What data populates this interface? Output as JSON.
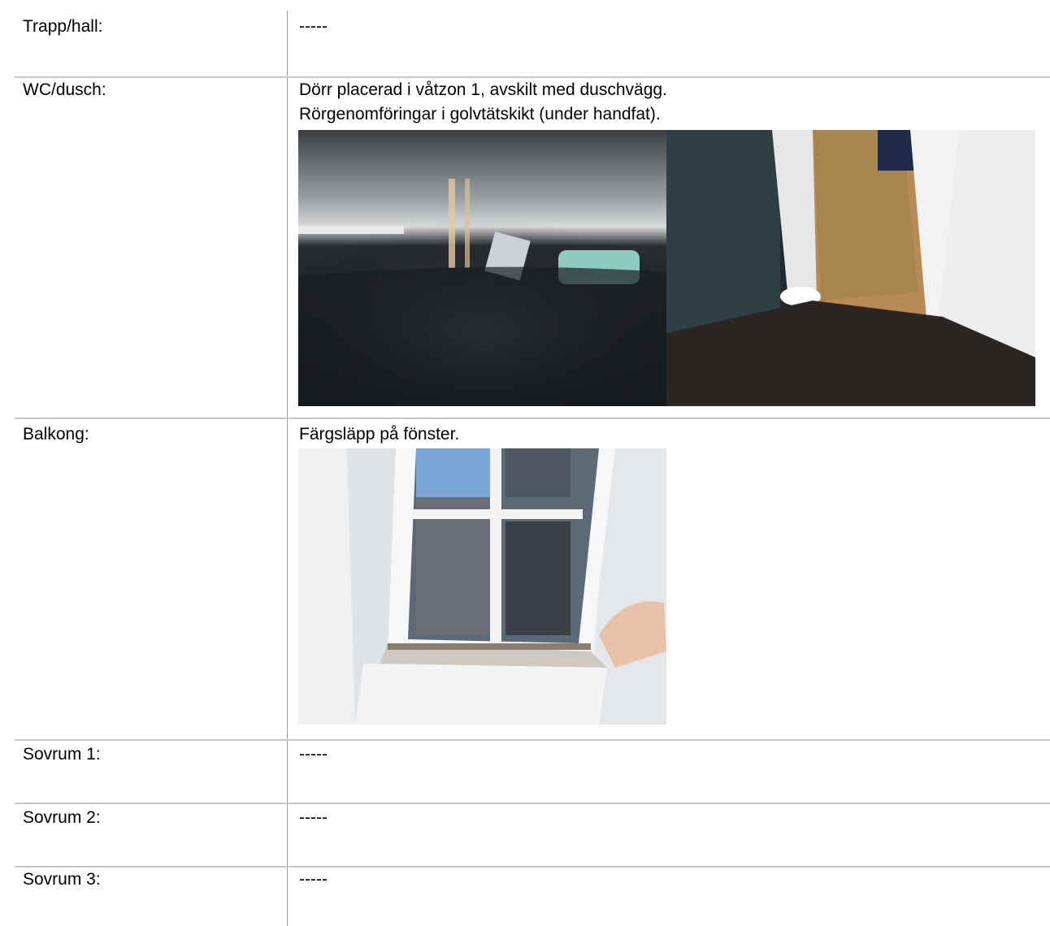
{
  "rows": [
    {
      "label": "Trapp/hall:",
      "lines": [
        "-----"
      ]
    },
    {
      "label": "WC/dusch:",
      "lines": [
        "Dörr placerad i våtzon 1, avskilt med duschvägg.",
        "Rörgenomföringar i golvtätskikt (under handfat)."
      ]
    },
    {
      "label": "Balkong:",
      "lines": [
        "Färgsläpp på fönster."
      ]
    },
    {
      "label": "Sovrum 1:",
      "lines": [
        "-----"
      ]
    },
    {
      "label": "Sovrum 2:",
      "lines": [
        "-----"
      ]
    },
    {
      "label": "Sovrum 3:",
      "lines": [
        "-----"
      ]
    }
  ],
  "photos": {
    "wc_left": "under-sink-floor-photo",
    "wc_right": "bathroom-door-threshold-photo",
    "balkong": "window-paint-peeling-photo"
  }
}
